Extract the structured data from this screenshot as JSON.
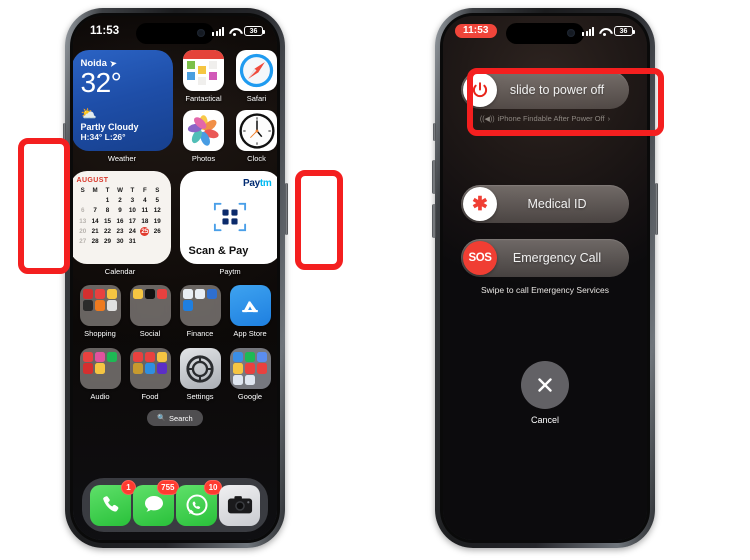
{
  "left_phone": {
    "name": "iphone-home-screen",
    "status_bar": {
      "time": "11:53",
      "battery": "36",
      "signal_icon": "cellular-signal-icon",
      "wifi_icon": "wifi-icon",
      "battery_icon": "battery-icon"
    },
    "weather_widget": {
      "city": "Noida",
      "location_icon": "location-arrow-icon",
      "temperature": "32°",
      "condition_icon": "partly-cloudy-icon",
      "condition": "Partly Cloudy",
      "high_low": "H:34° L:26°",
      "label": "Weather"
    },
    "apps_row1": [
      {
        "label": "Fantastical",
        "icon": "fantastical-icon"
      },
      {
        "label": "Safari",
        "icon": "safari-icon"
      }
    ],
    "apps_row2": [
      {
        "label": "Photos",
        "icon": "photos-icon"
      },
      {
        "label": "Clock",
        "icon": "clock-icon"
      }
    ],
    "calendar_widget": {
      "month": "AUGUST",
      "label": "Calendar",
      "dow": [
        "S",
        "M",
        "T",
        "W",
        "T",
        "F",
        "S"
      ],
      "weeks": [
        [
          "",
          "",
          "",
          "1",
          "2",
          "3",
          "4",
          "5"
        ],
        [
          "6",
          "7",
          "8",
          "9",
          "10",
          "11",
          "12"
        ],
        [
          "13",
          "14",
          "15",
          "16",
          "17",
          "18",
          "19"
        ],
        [
          "20",
          "21",
          "22",
          "23",
          "24",
          "25",
          "26"
        ],
        [
          "27",
          "28",
          "29",
          "30",
          "31",
          "",
          ""
        ]
      ],
      "today": "25"
    },
    "paytm_widget": {
      "logo_pay": "Pay",
      "logo_tm": "tm",
      "qr_icon": "qr-scan-icon",
      "title": "Scan & Pay",
      "label": "Paytm"
    },
    "folders_row1": [
      {
        "label": "Shopping",
        "icon": "shopping-folder-icon"
      },
      {
        "label": "Social",
        "icon": "social-folder-icon"
      },
      {
        "label": "Finance",
        "icon": "finance-folder-icon"
      },
      {
        "label": "App Store",
        "icon": "app-store-icon"
      }
    ],
    "folders_row2": [
      {
        "label": "Audio",
        "icon": "audio-folder-icon"
      },
      {
        "label": "Food",
        "icon": "food-folder-icon"
      },
      {
        "label": "Settings",
        "icon": "settings-icon"
      },
      {
        "label": "Google",
        "icon": "google-folder-icon"
      }
    ],
    "search": {
      "label": "Search",
      "icon": "search-icon"
    },
    "dock": [
      {
        "name": "phone",
        "icon": "phone-icon",
        "badge": "1"
      },
      {
        "name": "messages",
        "icon": "messages-icon",
        "badge": "755"
      },
      {
        "name": "whatsapp",
        "icon": "whatsapp-icon",
        "badge": "10"
      },
      {
        "name": "camera",
        "icon": "camera-icon",
        "badge": ""
      }
    ],
    "annotations": {
      "volume_buttons_box": "highlight-volume-buttons",
      "side_button_box": "highlight-side-button"
    }
  },
  "right_phone": {
    "name": "iphone-power-off-screen",
    "status_bar": {
      "time": "11:53",
      "battery": "36",
      "signal_icon": "cellular-signal-icon",
      "wifi_icon": "wifi-icon",
      "battery_icon": "battery-icon"
    },
    "power_slider": {
      "icon": "power-icon",
      "label": "slide to power off"
    },
    "findable": {
      "icon": "findmy-signal-icon",
      "text": "iPhone Findable After Power Off",
      "chevron": "›"
    },
    "medical_slider": {
      "icon": "medical-id-icon",
      "label": "Medical ID"
    },
    "sos_slider": {
      "icon": "sos-icon",
      "badge_text": "SOS",
      "label": "Emergency Call"
    },
    "swipe_note": "Swipe to call Emergency Services",
    "cancel": {
      "icon": "close-icon",
      "label": "Cancel"
    },
    "annotations": {
      "power_slider_box": "highlight-slide-to-power-off"
    }
  },
  "colors": {
    "annotation_red": "#f41f1f",
    "sos_red": "#f03e33",
    "accent_blue": "#2b63c4",
    "badge_red": "#ff3b30"
  }
}
